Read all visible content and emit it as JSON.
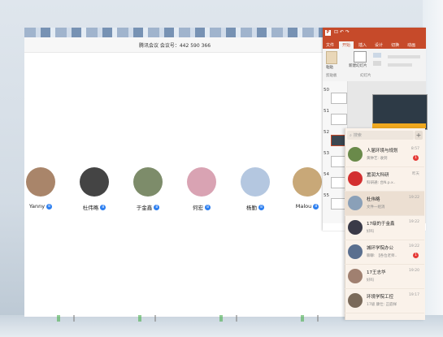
{
  "meeting": {
    "title": "腾讯会议 会议号：442 590 366",
    "participants": [
      {
        "name": "Yanny",
        "avatar_color": "#a9856a",
        "badge": "8"
      },
      {
        "name": "杜伟略",
        "avatar_color": "#444444",
        "badge": "8"
      },
      {
        "name": "于金鑫",
        "avatar_color": "#7d8c6a",
        "badge": "8"
      },
      {
        "name": "何宏",
        "avatar_color": "#d9a3b3",
        "badge": "8"
      },
      {
        "name": "杨勤",
        "avatar_color": "#b4c7e0",
        "badge": "8"
      },
      {
        "name": "Malou",
        "avatar_color": "#c8a878",
        "badge": "8"
      }
    ]
  },
  "ppt": {
    "title_icons": "⊡ ↶ ↷",
    "tabs": [
      "文件",
      "开始",
      "插入",
      "设计",
      "切换",
      "动画"
    ],
    "active_tab": "开始",
    "ribbon": {
      "paste": "粘贴",
      "new_slide": "新建幻灯片",
      "clipboard": "剪贴板",
      "slides": "幻灯片"
    },
    "slide_numbers": [
      "50",
      "51",
      "52",
      "53",
      "54",
      "55"
    ],
    "accent": "#c64a2a"
  },
  "chat": {
    "search_placeholder": "搜索",
    "add_symbol": "+",
    "conversations": [
      {
        "name": "人届环境与规划",
        "preview": "黄钟艺: 收到",
        "time": "8:57",
        "unread": "1",
        "avatar_color": "#6a8a4a"
      },
      {
        "name": "置润大科研",
        "preview": "科研通: 台N.p.x..",
        "time": "昨天",
        "unread": "",
        "avatar_color": "#d32f2f"
      },
      {
        "name": "杜伟略",
        "preview": "文件一组消",
        "time": "19:22",
        "unread": "",
        "avatar_color": "#8aa0b8"
      },
      {
        "name": "17级的于金鑫",
        "preview": "好吗",
        "time": "19:22",
        "unread": "",
        "avatar_color": "#3a3a48"
      },
      {
        "name": "城环学院办公",
        "preview": "聊聊: 【各位老师..",
        "time": "19:22",
        "unread": "1",
        "avatar_color": "#5a6f8f"
      },
      {
        "name": "17王志华",
        "preview": "好吗",
        "time": "19:20",
        "unread": "",
        "avatar_color": "#a08070"
      },
      {
        "name": "环境学院工控",
        "preview": "17级 康仕: 正庭样",
        "time": "19:17",
        "unread": "",
        "avatar_color": "#7a6a5a"
      }
    ]
  }
}
